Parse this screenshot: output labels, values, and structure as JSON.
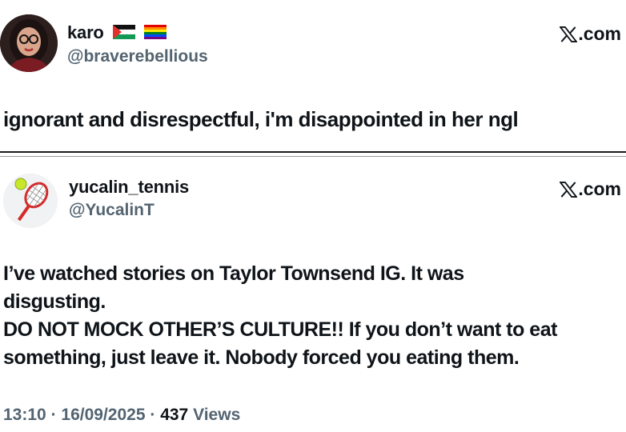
{
  "tweet1": {
    "display_name": "karo",
    "flag_icons": [
      "palestine-flag-icon",
      "rainbow-flag-icon"
    ],
    "handle": "@braverebellious",
    "brand": ".com",
    "text": "ignorant and disrespectful, i'm disappointed in her ngl"
  },
  "tweet2": {
    "display_name": "yucalin_tennis",
    "handle": "@YucalinT",
    "brand": ".com",
    "lines": [
      "I’ve watched stories on Taylor Townsend IG. It was",
      "disgusting.",
      "DO NOT MOCK OTHER’S CULTURE!! If you don’t want to eat",
      "something, just leave it. Nobody forced you eating them."
    ],
    "time": "13:10",
    "separator": "·",
    "date": "16/09/2025",
    "views_count": "437",
    "views_label": "Views"
  }
}
